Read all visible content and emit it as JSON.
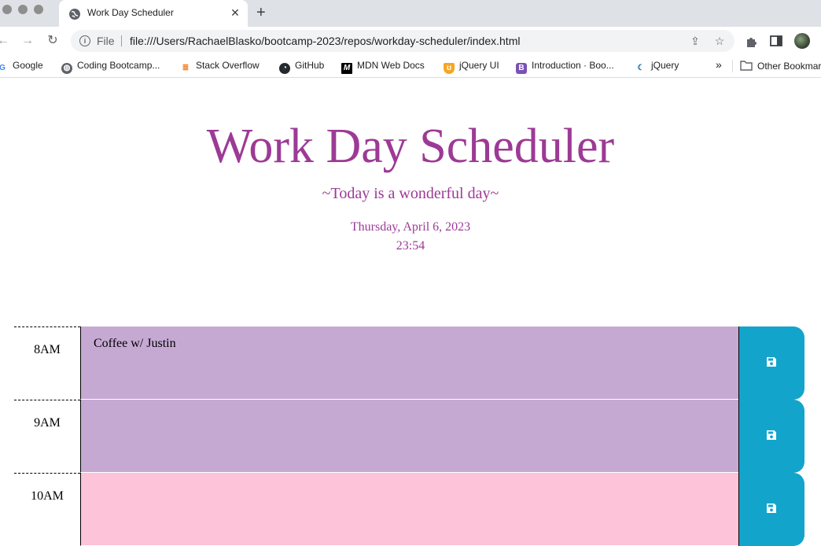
{
  "browser": {
    "tab": {
      "title": "Work Day Scheduler",
      "close": "✕"
    },
    "new_tab": "+",
    "nav": {
      "back": "←",
      "forward": "→",
      "reload": "↻"
    },
    "omnibox": {
      "scheme": "File",
      "url": "file:///Users/RachaelBlasko/bootcamp-2023/repos/workday-scheduler/index.html"
    },
    "bookmarks": [
      {
        "label": "Google",
        "icon": "google-icon",
        "color": "#4285f4"
      },
      {
        "label": "Coding Bootcamp...",
        "icon": "globe-icon",
        "color": "#5f6368"
      },
      {
        "label": "Stack Overflow",
        "icon": "stackoverflow-icon",
        "color": "#f48024"
      },
      {
        "label": "GitHub",
        "icon": "github-icon",
        "color": "#24292e"
      },
      {
        "label": "MDN Web Docs",
        "icon": "mdn-icon",
        "color": "#000000"
      },
      {
        "label": "jQuery UI",
        "icon": "jqueryui-icon",
        "color": "#f5a623"
      },
      {
        "label": "Introduction · Boo...",
        "icon": "bootstrap-icon",
        "color": "#7952b3"
      },
      {
        "label": "jQuery",
        "icon": "jquery-icon",
        "color": "#0769ad"
      }
    ],
    "bookmarks_overflow": "»",
    "other_bookmarks": "Other Bookmarks"
  },
  "page": {
    "title": "Work Day Scheduler",
    "lead": "~Today is a wonderful day~",
    "date": "Thursday, April 6, 2023",
    "time": "23:54",
    "colors": {
      "accent": "#9c3a95",
      "past": "#c5a9d3",
      "future": "#fdc3d8",
      "save": "#13a4cc"
    },
    "rows": [
      {
        "hour": "8AM",
        "text": "Coffee w/ Justin",
        "state": "past"
      },
      {
        "hour": "9AM",
        "text": "",
        "state": "past"
      },
      {
        "hour": "10AM",
        "text": "",
        "state": "future"
      }
    ]
  }
}
